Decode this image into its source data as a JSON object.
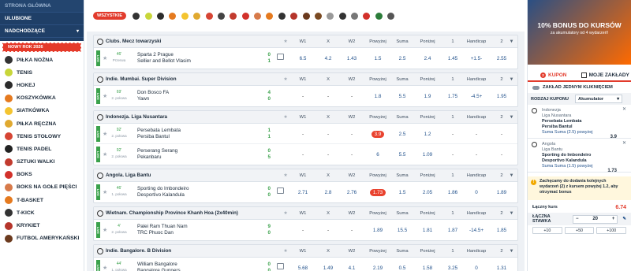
{
  "sidebar": {
    "top": [
      "STRONA GŁÓWNA",
      "ULUBIONE",
      "NADCHODZĄCE"
    ],
    "promo": "NOWY ROK 2026",
    "sports": [
      {
        "label": "PIŁKA NOŻNA",
        "color": "#333333",
        "icon": "soccer-ball-icon"
      },
      {
        "label": "TENIS",
        "color": "#c8d63a",
        "icon": "tennis-ball-icon"
      },
      {
        "label": "HOKEJ",
        "color": "#2c2c2c",
        "icon": "hockey-puck-icon"
      },
      {
        "label": "KOSZYKÓWKA",
        "color": "#e57a1f",
        "icon": "basketball-icon"
      },
      {
        "label": "SIATKÓWKA",
        "color": "#f4c430",
        "icon": "volleyball-icon"
      },
      {
        "label": "PIŁKA RĘCZNA",
        "color": "#e0a930",
        "icon": "handball-icon"
      },
      {
        "label": "TENIS STOŁOWY",
        "color": "#d64534",
        "icon": "table-tennis-icon"
      },
      {
        "label": "TENIS PADEL",
        "color": "#222222",
        "icon": "padel-icon"
      },
      {
        "label": "SZTUKI WALKI",
        "color": "#c23b2e",
        "icon": "martial-arts-icon"
      },
      {
        "label": "BOKS",
        "color": "#d2312b",
        "icon": "boxing-glove-icon"
      },
      {
        "label": "BOKS NA GOŁE PIĘŚCI",
        "color": "#d77a4a",
        "icon": "bare-knuckle-icon"
      },
      {
        "label": "T-BASKET",
        "color": "#e57a1f",
        "icon": "t-basket-icon"
      },
      {
        "label": "T-KICK",
        "color": "#333333",
        "icon": "t-kick-icon"
      },
      {
        "label": "KRYKIET",
        "color": "#b5352b",
        "icon": "cricket-icon"
      },
      {
        "label": "FUTBOL AMERYKAŃSKI",
        "color": "#6b3a1e",
        "icon": "american-football-icon"
      }
    ]
  },
  "filter": {
    "all_label": "WSZYSTKIE",
    "icons": [
      {
        "name": "soccer-filter-icon",
        "color": "#333"
      },
      {
        "name": "tennis-filter-icon",
        "color": "#c8d63a"
      },
      {
        "name": "hockey-filter-icon",
        "color": "#2c2c2c"
      },
      {
        "name": "basketball-filter-icon",
        "color": "#e57a1f"
      },
      {
        "name": "volleyball-filter-icon",
        "color": "#f4c430"
      },
      {
        "name": "handball-filter-icon",
        "color": "#e0a930"
      },
      {
        "name": "table-tennis-filter-icon",
        "color": "#d64534"
      },
      {
        "name": "padel-filter-icon",
        "color": "#444"
      },
      {
        "name": "martial-arts-filter-icon",
        "color": "#c23b2e"
      },
      {
        "name": "boxing-filter-icon",
        "color": "#d2312b"
      },
      {
        "name": "bare-knuckle-filter-icon",
        "color": "#d77a4a"
      },
      {
        "name": "t-basket-filter-icon",
        "color": "#e57a1f"
      },
      {
        "name": "t-kick-filter-icon",
        "color": "#333"
      },
      {
        "name": "cricket-filter-icon",
        "color": "#b5352b"
      },
      {
        "name": "american-football-filter-icon",
        "color": "#6b3a1e"
      },
      {
        "name": "rugby-filter-icon",
        "color": "#7a4a22"
      },
      {
        "name": "baseball-filter-icon",
        "color": "#999"
      },
      {
        "name": "esports-filter-icon",
        "color": "#333"
      },
      {
        "name": "badminton-filter-icon",
        "color": "#777"
      },
      {
        "name": "darts-filter-icon",
        "color": "#d2312b"
      },
      {
        "name": "snooker-filter-icon",
        "color": "#2c7d3a"
      },
      {
        "name": "more-sports-filter-icon",
        "color": "#555"
      }
    ]
  },
  "columns": [
    "W1",
    "X",
    "W2",
    "Powyżej",
    "Suma",
    "Poniżej",
    "1",
    "Handicap",
    "2"
  ],
  "leagues": [
    {
      "name": "Clubs. Mecz towarzyski",
      "matches": [
        {
          "minute": "46'",
          "period": "Przerwa",
          "home": "Sparta 2 Prague",
          "away": "Sellier and Bellot Vlasim",
          "sh": "0",
          "sa": "1",
          "stats": true,
          "odds": [
            "6.5",
            "4.2",
            "1.43",
            "1.5",
            "2.5",
            "2.4",
            "1.45",
            "+1.5-",
            "2.55"
          ],
          "hl": -1
        }
      ]
    },
    {
      "name": "Indie. Mumbai. Super Division",
      "matches": [
        {
          "minute": "69'",
          "period": "2. połowa",
          "home": "Don Bosco FA",
          "away": "Yawn",
          "sh": "4",
          "sa": "0",
          "stats": false,
          "odds": [
            "-",
            "-",
            "-",
            "1.8",
            "5.5",
            "1.9",
            "1.75",
            "-4.5+",
            "1.95"
          ],
          "hl": -1
        }
      ]
    },
    {
      "name": "Indonezja. Liga Nusantara",
      "matches": [
        {
          "minute": "92'",
          "period": "2. połowa",
          "home": "Persebata Lembata",
          "away": "Persiba Bantul",
          "sh": "1",
          "sa": "1",
          "stats": false,
          "odds": [
            "-",
            "-",
            "-",
            "3.9",
            "2.5",
            "1.2",
            "-",
            "-",
            "-"
          ],
          "hl": 3
        },
        {
          "minute": "92'",
          "period": "2. połowa",
          "home": "Perserang Serang",
          "away": "Pekanbaru",
          "sh": "0",
          "sa": "5",
          "stats": false,
          "odds": [
            "-",
            "-",
            "-",
            "6",
            "5.5",
            "1.09",
            "-",
            "-",
            "-"
          ],
          "hl": -1
        }
      ]
    },
    {
      "name": "Angola. Liga Bantu",
      "matches": [
        {
          "minute": "46'",
          "period": "1. połowa",
          "home": "Sporting do Imbondeiro",
          "away": "Desportivo Kalandula",
          "sh": "0",
          "sa": "0",
          "stats": true,
          "odds": [
            "2.71",
            "2.8",
            "2.76",
            "1.73",
            "1.5",
            "2.05",
            "1.86",
            "0",
            "1.89"
          ],
          "hl": 3
        }
      ]
    },
    {
      "name": "Wietnam. Championship Province Khanh Hoa (2x40min)",
      "matches": [
        {
          "minute": "4'",
          "period": "2. połowa",
          "home": "Palei Ram Thuan Nam",
          "away": "TRC Phuoc Dan",
          "sh": "9",
          "sa": "0",
          "stats": false,
          "odds": [
            "-",
            "-",
            "-",
            "1.89",
            "15.5",
            "1.81",
            "1.87",
            "-14.5+",
            "1.85"
          ],
          "hl": -1
        }
      ]
    },
    {
      "name": "Indie. Bangalore. B Division",
      "matches": [
        {
          "minute": "44'",
          "period": "1. połowa",
          "home": "William Bangalore",
          "away": "Bangalore Gunners",
          "sh": "0",
          "sa": "0",
          "stats": true,
          "odds": [
            "5.68",
            "1.49",
            "4.1",
            "2.19",
            "0.5",
            "1.58",
            "3.25",
            "0",
            "1.31"
          ],
          "hl": -1
        }
      ]
    }
  ],
  "right": {
    "promo_big": "10% BONUS DO KURSÓW",
    "promo_small": "za akumulatory od 4 wydarzeń!",
    "tab_kupon": "KUPON",
    "tab_kupon_count": "2",
    "tab_moje": "MOJE ZAKŁADY",
    "one_click": "ZAKŁAD JEDNYM KLIKNIĘCIEM",
    "rodzaj_label": "RODZAJ KUPONU",
    "rodzaj_value": "Akumulator",
    "bets": [
      {
        "country": "Indonezja",
        "league": "Liga Nusantara",
        "home": "Persebata Lembata",
        "away": "Persiba Bantul",
        "market": "Suma   Suma (2.5) powyżej",
        "odd": "3.9"
      },
      {
        "country": "Angola",
        "league": "Liga Bantu",
        "home": "Sporting do Imbondeiro",
        "away": "Desportivo Kalandula",
        "market": "Suma   Suma (1.5) powyżej",
        "odd": "1.73"
      }
    ],
    "warning": "Zachęcamy do dodania kolejnych wydarzeń (2) z kursem powyżej 1.2, aby otrzymać bonus",
    "total_label": "Łączny kurs",
    "total_value": "6.74",
    "stake_label": "ŁĄCZNA STAWKA",
    "stake_value": "20",
    "quick": [
      "+10",
      "+50",
      "+100"
    ]
  }
}
